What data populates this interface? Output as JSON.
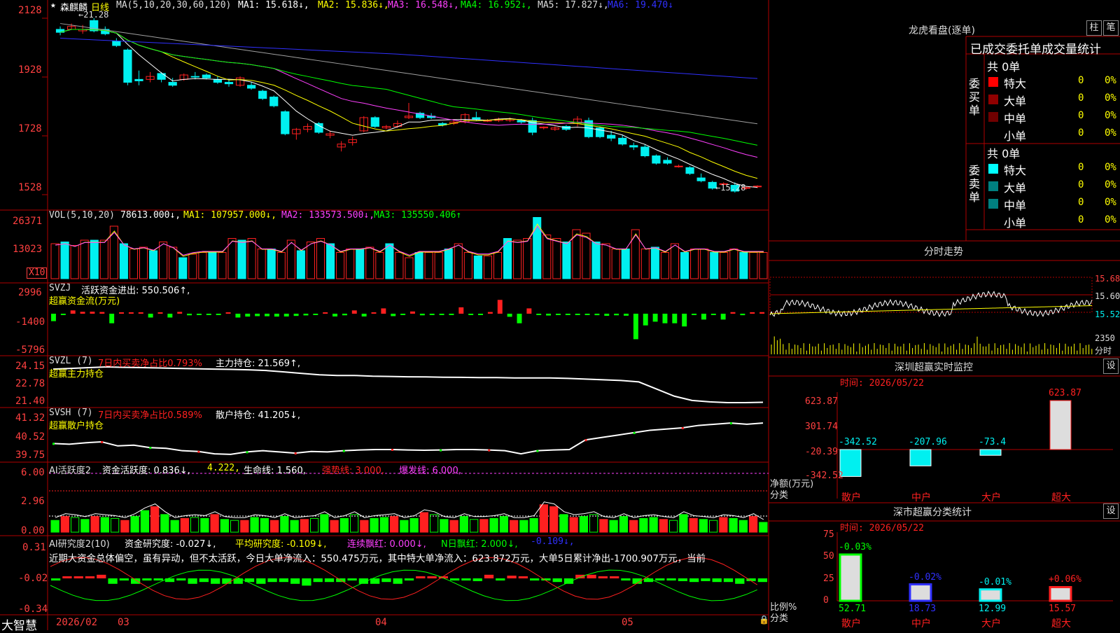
{
  "colors": {
    "up": "#ff2020",
    "down": "#00f0f0",
    "ma1": "#ffffff",
    "ma2": "#ffff00",
    "ma3": "#ff40ff",
    "ma4": "#00ff00",
    "ma5": "#a0a0a0",
    "ma6": "#3030ff",
    "grid": "#b00000",
    "green": "#00ff00",
    "axisRed": "#ff4040"
  },
  "header": {
    "star": "★",
    "stock_name": "森麒麟",
    "period": "日线",
    "ma_params": "MA(5,10,20,30,60,120)",
    "ma1": "MA1: 15.618↓,",
    "ma2": "MA2: 15.836↓,",
    "ma3": "MA3: 16.548↓,",
    "ma4": "MA4: 16.952↓,",
    "ma5": "MA5: 17.827↓,",
    "ma6": "MA6: 19.470↓"
  },
  "price_axis": [
    "2128",
    "1928",
    "1728",
    "1528"
  ],
  "price_high_label": "←21.28",
  "price_low_label": "←15.28",
  "vol": {
    "title": "VOL(5,10,20)",
    "value": "78613.000↓,",
    "ma1": "MA1: 107957.000↓,",
    "ma2": "MA2: 133573.500↓,",
    "ma3": "MA3: 135550.406↑",
    "axis": [
      "26371",
      "13023"
    ],
    "unit": "X10"
  },
  "svzj": {
    "title": "SVZJ",
    "label": "活跃资金进出: 550.506↑,",
    "sub": "超赢资金流(万元)",
    "axis": [
      "2996",
      "-1400",
      "-5796"
    ]
  },
  "svzl": {
    "title": "SVZL (7)",
    "label1": "7日内买卖净占比0.793%",
    "label2": "主力持仓: 21.569↑,",
    "sub": "超赢主力持仓",
    "axis": [
      "24.15",
      "22.78",
      "21.40"
    ]
  },
  "svsh": {
    "title": "SVSH (7)",
    "label1": "7日内买卖净占比0.589%",
    "label2": "散户持仓: 41.205↓,",
    "sub": "超赢散户持仓",
    "axis": [
      "41.32",
      "40.52",
      "39.75"
    ]
  },
  "ai1": {
    "title": "AI活跃度2",
    "label": "资金活跃度: 0.836↓,",
    "val2": "4.222,",
    "life": "生命线: 1.560,",
    "strong": "强势线: 3.000,",
    "burst": "爆发线: 6.000,",
    "axis": [
      "6.00",
      "2.96",
      "0.00"
    ]
  },
  "ai2": {
    "title": "AI研究度2(10)",
    "label": "资金研究度: -0.027↓,",
    "avg": "平均研究度: -0.109↓,",
    "red": "连续飘红: 0.000↓,",
    "n": "N日飘红: 2.000↓,",
    "last": "-0.109↓,",
    "axis": [
      "0.31",
      "-0.02",
      "-0.34"
    ],
    "commentary": "近期大资金总体偏空，虽有异动，但不太活跃，今日大单净流入：550.475万元，其中特大单净流入：623.872万元，大单5日累计净出-1700.907万元，当前"
  },
  "bottom": {
    "brand": "大智慧",
    "dates": [
      "2026/02",
      "03",
      "04",
      "05"
    ]
  },
  "right": {
    "title": "龙虎看盘(逐单)",
    "btn1": "柱",
    "btn2": "笔",
    "table_title": "已成交委托单成交量统计",
    "buy_total": "共 0单",
    "buy_label": "委买单",
    "sell_total": "共 0单",
    "sell_label": "委卖单",
    "rows_buy": [
      {
        "name": "特大",
        "v": "0",
        "p": "0%",
        "c": "#ff0000"
      },
      {
        "name": "大单",
        "v": "0",
        "p": "0%",
        "c": "#900000"
      },
      {
        "name": "中单",
        "v": "0",
        "p": "0%",
        "c": "#700000"
      },
      {
        "name": "小单",
        "v": "0",
        "p": "0%",
        "c": "#000000"
      }
    ],
    "rows_sell": [
      {
        "name": "特大",
        "v": "0",
        "p": "0%",
        "c": "#00ffff"
      },
      {
        "name": "大单",
        "v": "0",
        "p": "0%",
        "c": "#008080"
      },
      {
        "name": "中单",
        "v": "0",
        "p": "0%",
        "c": "#008080"
      },
      {
        "name": "小单",
        "v": "0",
        "p": "0%",
        "c": "#000000"
      }
    ],
    "intraday_title": "分时走势",
    "intraday_axis": [
      "15.68",
      "15.60",
      "15.52"
    ],
    "intraday_vol": "2350",
    "intraday_vol_unit": "分时",
    "monitor_title": "深圳超赢实时监控",
    "monitor_btn": "设",
    "monitor_time": "时间: 2026/05/22",
    "monitor_axis": [
      "623.87",
      "301.74",
      "-20.39",
      "-342.52"
    ],
    "monitor_ylabel": "净额(万元)",
    "monitor_xlabel": "分类",
    "monitor_cats": [
      "散户",
      "中户",
      "大户",
      "超大"
    ],
    "monitor_vals": [
      "-342.52",
      "-207.96",
      "-73.4",
      "623.87"
    ],
    "class_title": "深市超赢分类统计",
    "class_btn": "设",
    "class_time": "时间: 2026/05/22",
    "class_axis": [
      "75",
      "50",
      "25",
      "0"
    ],
    "class_ylabel": "比例%",
    "class_xlabel": "分类",
    "class_cats": [
      "散户",
      "中户",
      "大户",
      "超大"
    ],
    "class_vals": [
      "52.71",
      "18.73",
      "12.99",
      "15.57"
    ],
    "class_chg": [
      "-0.03%",
      "-0.02%",
      "-0.01%",
      "+0.06%"
    ]
  },
  "chart_data": [
    {
      "type": "candlestick",
      "title": "森麒麟 日线",
      "ylim": [
        15.28,
        21.28
      ],
      "ohlc": [
        [
          20.9,
          21.0,
          20.7,
          20.8
        ],
        [
          20.9,
          21.1,
          20.9,
          21.0
        ],
        [
          20.85,
          21.05,
          20.75,
          20.9
        ],
        [
          21.2,
          21.28,
          20.8,
          20.85
        ],
        [
          20.9,
          21.0,
          20.7,
          20.75
        ],
        [
          20.5,
          20.6,
          20.3,
          20.35
        ],
        [
          20.2,
          20.25,
          19.0,
          19.1
        ],
        [
          19.2,
          19.5,
          19.0,
          19.15
        ],
        [
          19.2,
          19.45,
          19.1,
          19.3
        ],
        [
          19.4,
          19.45,
          19.1,
          19.2
        ],
        [
          19.1,
          19.25,
          18.95,
          19.0
        ],
        [
          19.2,
          19.4,
          19.15,
          19.35
        ],
        [
          19.3,
          19.45,
          19.2,
          19.28
        ],
        [
          19.35,
          19.4,
          19.2,
          19.25
        ],
        [
          19.2,
          19.3,
          19.05,
          19.1
        ],
        [
          19.1,
          19.2,
          18.95,
          19.05
        ],
        [
          19.0,
          19.3,
          18.95,
          19.25
        ],
        [
          19.0,
          19.1,
          18.85,
          18.9
        ],
        [
          18.8,
          18.85,
          18.5,
          18.55
        ],
        [
          18.6,
          18.65,
          18.25,
          18.3
        ],
        [
          18.1,
          18.15,
          17.3,
          17.35
        ],
        [
          17.35,
          17.55,
          17.15,
          17.5
        ],
        [
          17.5,
          17.7,
          17.4,
          17.6
        ],
        [
          17.7,
          17.75,
          17.35,
          17.4
        ],
        [
          17.3,
          17.45,
          17.2,
          17.35
        ],
        [
          16.9,
          17.1,
          16.75,
          17.0
        ],
        [
          17.05,
          17.25,
          16.95,
          17.15
        ],
        [
          17.45,
          17.95,
          17.4,
          17.9
        ],
        [
          17.9,
          17.95,
          17.55,
          17.6
        ],
        [
          17.55,
          17.65,
          17.5,
          17.6
        ],
        [
          17.6,
          17.8,
          17.55,
          17.7
        ],
        [
          17.9,
          18.4,
          17.85,
          17.95
        ],
        [
          18.05,
          18.1,
          17.85,
          17.9
        ],
        [
          17.95,
          18.05,
          17.85,
          17.9
        ],
        [
          17.7,
          17.75,
          17.6,
          17.65
        ],
        [
          17.7,
          17.85,
          17.65,
          17.75
        ],
        [
          17.75,
          18.05,
          17.7,
          18.0
        ],
        [
          17.9,
          18.1,
          17.8,
          17.85
        ],
        [
          17.8,
          17.85,
          17.75,
          17.8
        ],
        [
          17.8,
          17.9,
          17.75,
          17.85
        ],
        [
          17.8,
          17.9,
          17.75,
          17.85
        ],
        [
          17.8,
          17.85,
          17.7,
          17.75
        ],
        [
          17.8,
          17.9,
          17.3,
          17.4
        ],
        [
          17.55,
          17.6,
          17.5,
          17.58
        ],
        [
          17.5,
          17.6,
          17.45,
          17.55
        ],
        [
          17.6,
          17.65,
          17.45,
          17.5
        ],
        [
          17.7,
          17.95,
          17.6,
          17.85
        ],
        [
          17.8,
          17.9,
          17.2,
          17.25
        ],
        [
          17.55,
          17.6,
          17.2,
          17.25
        ],
        [
          17.3,
          17.45,
          17.1,
          17.2
        ],
        [
          17.2,
          17.3,
          16.95,
          17.0
        ],
        [
          16.95,
          17.05,
          16.8,
          16.9
        ],
        [
          16.9,
          17.0,
          16.55,
          16.6
        ],
        [
          16.6,
          16.65,
          16.3,
          16.35
        ],
        [
          16.45,
          16.55,
          16.3,
          16.35
        ],
        [
          16.25,
          16.3,
          16.2,
          16.25
        ],
        [
          16.2,
          16.25,
          15.95,
          16.0
        ],
        [
          15.85,
          16.0,
          15.7,
          15.75
        ],
        [
          15.7,
          15.75,
          15.45,
          15.5
        ],
        [
          15.65,
          15.7,
          15.62,
          15.65
        ],
        [
          15.6,
          15.7,
          15.35,
          15.4
        ],
        [
          15.5,
          15.55,
          15.45,
          15.52
        ],
        [
          15.55,
          15.6,
          15.5,
          15.57
        ]
      ]
    },
    {
      "type": "bar",
      "title": "VOL",
      "ylim": [
        0,
        26371
      ],
      "values": [
        40,
        42,
        38,
        44,
        44,
        44,
        60,
        40,
        34,
        36,
        32,
        42,
        36,
        24,
        28,
        30,
        30,
        30,
        46,
        44,
        46,
        34,
        34,
        30,
        44,
        32,
        42,
        46,
        40,
        30,
        34,
        34,
        36,
        30,
        40,
        30,
        24,
        30,
        30,
        30,
        34,
        40,
        30,
        26,
        26,
        30,
        46,
        44,
        46,
        70,
        50,
        46,
        42,
        56,
        52,
        42,
        40,
        34,
        34,
        56,
        34,
        36,
        30,
        40,
        30,
        34,
        34,
        30,
        30,
        34,
        30,
        30,
        30
      ]
    },
    {
      "type": "bar",
      "title": "SVZJ",
      "ylim": [
        -5796,
        2996
      ],
      "values": [
        -1400,
        -180,
        620,
        360,
        380,
        320,
        -1800,
        200,
        100,
        180,
        -720,
        180,
        -720,
        340,
        -300,
        -160,
        -160,
        -160,
        80,
        -720,
        -540,
        -460,
        -480,
        -540,
        -520,
        -420,
        -320,
        -240,
        220,
        -520,
        -300,
        620,
        -520,
        220,
        1000,
        -460,
        -200,
        420,
        -300,
        -200,
        -220,
        -100,
        1200,
        -220,
        -200,
        320,
        2600,
        -580,
        -1800,
        1000,
        -220,
        -340,
        -100,
        -200,
        -100,
        -260,
        -280,
        -400,
        -300,
        -380,
        -4800,
        -2200,
        -1500,
        -1800,
        -1800,
        -2400,
        -200,
        -1100,
        -200,
        -1100,
        300,
        -280,
        280,
        300
      ]
    },
    {
      "type": "line",
      "title": "超赢主力持仓",
      "ylim": [
        21.4,
        24.15
      ],
      "values": [
        23.9,
        23.95,
        24.0,
        24.05,
        24.02,
        24.0,
        23.98,
        23.95,
        23.92,
        23.9,
        23.88,
        23.85,
        23.8,
        23.7,
        23.6,
        23.5,
        23.45,
        23.45,
        23.4,
        23.38,
        23.36,
        23.35,
        23.33,
        23.32,
        23.3,
        23.3,
        23.28,
        23.28,
        23.28,
        23.25,
        23.2,
        23.15,
        23.1,
        23.0,
        22.5,
        22.0,
        21.7,
        21.6,
        21.55,
        21.55,
        21.57
      ]
    },
    {
      "type": "line",
      "title": "超赢散户持仓",
      "ylim": [
        39.75,
        41.32
      ],
      "values": [
        40.35,
        40.32,
        40.38,
        40.42,
        40.25,
        40.28,
        40.18,
        40.15,
        40.05,
        40.02,
        39.92,
        39.9,
        40.0,
        40.05,
        40.0,
        39.95,
        40.02,
        40.0,
        40.05,
        40.08,
        40.1,
        40.1,
        40.08,
        40.07,
        40.08,
        40.1,
        40.1,
        40.08,
        40.05,
        39.92,
        40.05,
        40.08,
        40.1,
        40.5,
        40.6,
        40.7,
        40.8,
        40.9,
        40.95,
        41.0,
        41.1,
        41.15,
        41.2,
        41.15,
        41.2
      ]
    },
    {
      "type": "bar",
      "title": "AI活跃度2",
      "ylim": [
        0,
        6.0
      ],
      "values": [
        1.2,
        1.6,
        1.5,
        1.3,
        1.6,
        1.5,
        1.4,
        1.2,
        1.6,
        2.2,
        2.6,
        1.8,
        1.2,
        1.4,
        1.5,
        1.4,
        1.8,
        1.3,
        1.2,
        1.2,
        1.5,
        1.4,
        1.2,
        1.6,
        1.2,
        1.3,
        1.4,
        1.8,
        1.2,
        1.4,
        1.8,
        1.2,
        1.4,
        1.5,
        1.6,
        1.2,
        1.4,
        2.0,
        1.8,
        1.3,
        1.2,
        1.6,
        1.3,
        1.3,
        1.4,
        1.6,
        1.2,
        1.2,
        1.4,
        2.8,
        2.6,
        1.8,
        1.5,
        1.6,
        1.8,
        1.3,
        1.2,
        1.6,
        1.2,
        1.4,
        1.5,
        1.3,
        1.2,
        1.8,
        1.4,
        1.3,
        1.2,
        1.5,
        1.4,
        1.2,
        1.6,
        1.0
      ]
    },
    {
      "type": "bar",
      "title": "AI研究度2(10)",
      "ylim": [
        -0.34,
        0.31
      ],
      "values": [
        -0.02,
        0.02,
        0.01,
        0.02,
        0.04,
        -0.06,
        -0.02,
        -0.06,
        -0.02,
        -0.02,
        -0.04,
        -0.02,
        -0.06,
        -0.04,
        -0.06,
        -0.06,
        -0.06,
        -0.04,
        -0.06,
        -0.04,
        -0.04,
        -0.06,
        -0.08,
        -0.04,
        -0.04,
        -0.04,
        -0.02,
        -0.06,
        -0.06,
        -0.04,
        -0.06,
        -0.02,
        0.02,
        0.01,
        0.01,
        -0.02,
        -0.02,
        -0.03,
        0.04,
        -0.02,
        0.03,
        0.01,
        -0.02,
        -0.02,
        -0.04,
        -0.06,
        0.04,
        0.04,
        0.02,
        0.02,
        -0.02,
        -0.06,
        -0.04,
        -0.02,
        -0.02,
        -0.03,
        -0.04,
        -0.03,
        -0.04,
        -0.04,
        -0.06,
        -0.03,
        -0.04
      ]
    },
    {
      "type": "bar",
      "title": "深圳超赢实时监控",
      "categories": [
        "散户",
        "中户",
        "大户",
        "超大"
      ],
      "values": [
        -342.52,
        -207.96,
        -73.4,
        623.87
      ],
      "ylim": [
        -342.52,
        623.87
      ]
    },
    {
      "type": "bar",
      "title": "深市超赢分类统计",
      "categories": [
        "散户",
        "中户",
        "大户",
        "超大"
      ],
      "values": [
        52.71,
        18.73,
        12.99,
        15.57
      ],
      "ylim": [
        0,
        75
      ]
    }
  ]
}
